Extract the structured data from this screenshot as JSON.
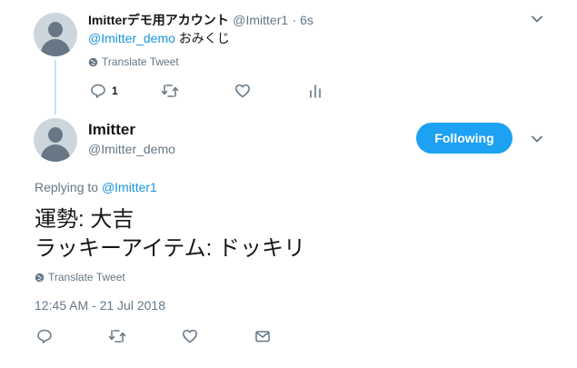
{
  "parent_tweet": {
    "display_name": "Imitterデモ用アカウント",
    "handle": "@Imitter1",
    "time": "· 6s",
    "mention": "@Imitter_demo",
    "text": "おみくじ",
    "translate": "Translate Tweet",
    "reply_count": "1"
  },
  "main_tweet": {
    "display_name": "Imitter",
    "handle": "@Imitter_demo",
    "follow_label": "Following",
    "replying_prefix": "Replying to",
    "replying_to": "@Imitter1",
    "line1": "運勢: 大吉",
    "line2": "ラッキーアイテム: ドッキリ",
    "translate": "Translate Tweet",
    "timestamp": "12:45 AM - 21 Jul 2018"
  },
  "colors": {
    "accent": "#1da1f2",
    "link": "#1b95e0",
    "muted": "#657786",
    "thread_line": "#c4e5f7"
  }
}
